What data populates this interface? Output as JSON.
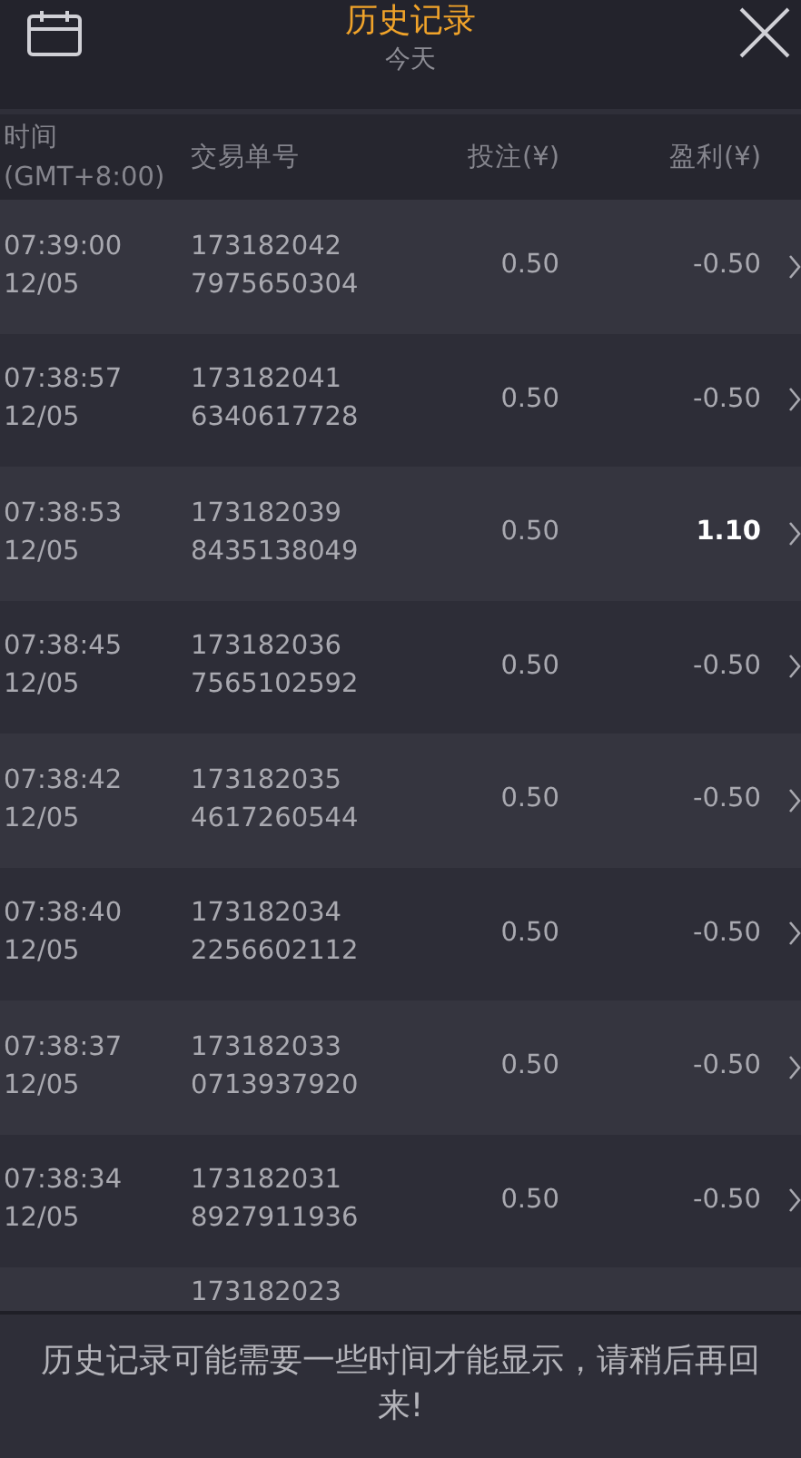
{
  "header": {
    "title": "历史记录",
    "subtitle": "今天"
  },
  "columns": {
    "time": [
      "时间",
      "(GMT+8:00)"
    ],
    "order": "交易单号",
    "bet": "投注(¥)",
    "profit": "盈利(¥)"
  },
  "rows": [
    {
      "time": "07:39:00",
      "date": "12/05",
      "order": [
        "173182042",
        "7975650304"
      ],
      "bet": "0.50",
      "profit": "-0.50",
      "won": false
    },
    {
      "time": "07:38:57",
      "date": "12/05",
      "order": [
        "173182041",
        "6340617728"
      ],
      "bet": "0.50",
      "profit": "-0.50",
      "won": false
    },
    {
      "time": "07:38:53",
      "date": "12/05",
      "order": [
        "173182039",
        "8435138049"
      ],
      "bet": "0.50",
      "profit": "1.10",
      "won": true
    },
    {
      "time": "07:38:45",
      "date": "12/05",
      "order": [
        "173182036",
        "7565102592"
      ],
      "bet": "0.50",
      "profit": "-0.50",
      "won": false
    },
    {
      "time": "07:38:42",
      "date": "12/05",
      "order": [
        "173182035",
        "4617260544"
      ],
      "bet": "0.50",
      "profit": "-0.50",
      "won": false
    },
    {
      "time": "07:38:40",
      "date": "12/05",
      "order": [
        "173182034",
        "2256602112"
      ],
      "bet": "0.50",
      "profit": "-0.50",
      "won": false
    },
    {
      "time": "07:38:37",
      "date": "12/05",
      "order": [
        "173182033",
        "0713937920"
      ],
      "bet": "0.50",
      "profit": "-0.50",
      "won": false
    },
    {
      "time": "07:38:34",
      "date": "12/05",
      "order": [
        "173182031",
        "8927911936"
      ],
      "bet": "0.50",
      "profit": "-0.50",
      "won": false
    },
    {
      "order": [
        "173182023"
      ]
    }
  ],
  "footer": "历史记录可能需要一些时间才能显示，请稍后再回来!"
}
